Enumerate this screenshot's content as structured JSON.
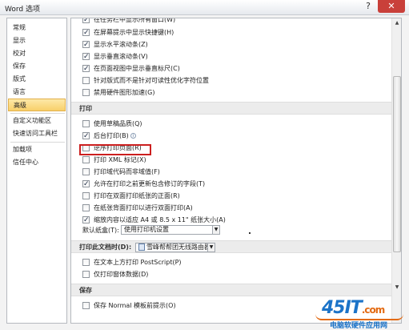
{
  "window": {
    "title": "Word 选项",
    "help_glyph": "?",
    "close_glyph": "✕"
  },
  "sidebar": {
    "items": [
      {
        "label": "常规"
      },
      {
        "label": "显示"
      },
      {
        "label": "校对"
      },
      {
        "label": "保存"
      },
      {
        "label": "版式"
      },
      {
        "label": "语言"
      },
      {
        "label": "高级"
      },
      {
        "label": "自定义功能区"
      },
      {
        "label": "快速访问工具栏"
      },
      {
        "label": "加载项"
      },
      {
        "label": "信任中心"
      }
    ],
    "active_index": 6
  },
  "display_options": [
    {
      "label": "在任务栏中显示所有窗口(W)",
      "checked": true
    },
    {
      "label": "在屏幕提示中显示快捷键(H)",
      "checked": true
    },
    {
      "label": "显示水平滚动条(Z)",
      "checked": true
    },
    {
      "label": "显示垂直滚动条(V)",
      "checked": true
    },
    {
      "label": "在页面视图中显示垂直标尺(C)",
      "checked": true
    },
    {
      "label": "针对版式而不是针对可读性优化字符位置",
      "checked": false
    },
    {
      "label": "禁用硬件图形加速(G)",
      "checked": false
    }
  ],
  "print_section": {
    "title": "打印",
    "options": [
      {
        "label": "使用草稿品质(Q)",
        "checked": false
      },
      {
        "label": "后台打印(B)",
        "checked": true,
        "info": true
      },
      {
        "label": "逆序打印页面(R)",
        "checked": false
      },
      {
        "label": "打印 XML 标记(X)",
        "checked": false
      },
      {
        "label": "打印域代码而非域值(F)",
        "checked": false
      },
      {
        "label": "允许在打印之前更新包含修订的字段(T)",
        "checked": true
      },
      {
        "label": "打印在双面打印纸张的正面(R)",
        "checked": false
      },
      {
        "label": "在纸张背面打印以进行双面打印(A)",
        "checked": false
      },
      {
        "label": "缩放内容以适应 A4 或 8.5 x 11\" 纸张大小(A)",
        "checked": true
      }
    ],
    "tray_label": "默认纸盒(T):",
    "tray_value": "使用打印机设置"
  },
  "print_doc_section": {
    "title": "打印此文档时(D):",
    "doc_value": "雪峰帮帮团无线路由器",
    "options": [
      {
        "label": "在文本上方打印 PostScript(P)",
        "checked": false
      },
      {
        "label": "仅打印窗体数据(D)",
        "checked": false
      }
    ]
  },
  "save_section": {
    "title": "保存",
    "options": [
      {
        "label": "保存 Normal 模板前提示(O)",
        "checked": false
      }
    ]
  },
  "scrollbar": {
    "up_glyph": "▲",
    "down_glyph": "▼"
  },
  "watermark": {
    "logo": "45IT",
    "suffix": ".com",
    "subtitle": "电脑软硬件应用网"
  }
}
